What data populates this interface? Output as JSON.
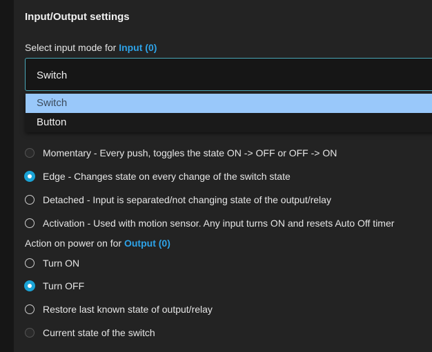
{
  "settings": {
    "title": "Input/Output settings",
    "input_mode": {
      "label_prefix": "Select input mode for ",
      "label_accent": "Input (0)",
      "selected_value": "Switch",
      "dropdown_options": [
        "Switch",
        "Button"
      ],
      "highlighted_option": "Switch"
    },
    "switch_modes": [
      {
        "label": "Momentary - Every push, toggles the state ON -> OFF or OFF -> ON",
        "checked": false,
        "faded": true
      },
      {
        "label": "Edge - Changes state on every change of the switch state",
        "checked": true,
        "faded": false
      },
      {
        "label": "Detached - Input is separated/not changing state of the output/relay",
        "checked": false,
        "faded": false
      },
      {
        "label": "Activation - Used with motion sensor. Any input turns ON and resets Auto Off timer",
        "checked": false,
        "faded": false
      }
    ],
    "power_on": {
      "label_prefix": "Action on power on for ",
      "label_accent": "Output (0)",
      "options": [
        {
          "label": "Turn ON",
          "checked": false,
          "faded": false
        },
        {
          "label": "Turn OFF",
          "checked": true,
          "faded": false
        },
        {
          "label": "Restore last known state of output/relay",
          "checked": false,
          "faded": false
        },
        {
          "label": "Current state of the switch",
          "checked": false,
          "faded": true
        }
      ]
    }
  },
  "colors": {
    "accent": "#2ea3e8",
    "radio_checked": "#1aa3d6",
    "dropdown_highlight": "#99c8fa"
  }
}
